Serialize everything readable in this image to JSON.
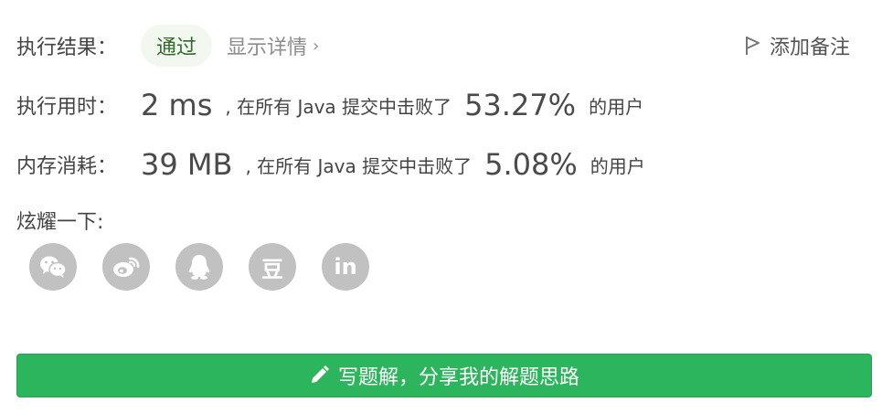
{
  "result": {
    "label": "执行结果：",
    "status": "通过",
    "detail_link": "显示详情",
    "add_note": "添加备注"
  },
  "runtime": {
    "label": "执行用时：",
    "value": "2 ms",
    "mid_text": ", 在所有 Java 提交中击败了",
    "percent": "53.27%",
    "suffix": "的用户"
  },
  "memory": {
    "label": "内存消耗：",
    "value": "39 MB",
    "mid_text": ", 在所有 Java 提交中击败了",
    "percent": "5.08%",
    "suffix": "的用户"
  },
  "share": {
    "label": "炫耀一下:",
    "icons": [
      "wechat-icon",
      "weibo-icon",
      "qq-icon",
      "douban-icon",
      "linkedin-icon"
    ],
    "douban_glyph": "豆",
    "linkedin_glyph": "in",
    "icon_bg": "#c1c1c1"
  },
  "write_button": {
    "label": "写题解，分享我的解题思路",
    "color": "#2db55d"
  }
}
